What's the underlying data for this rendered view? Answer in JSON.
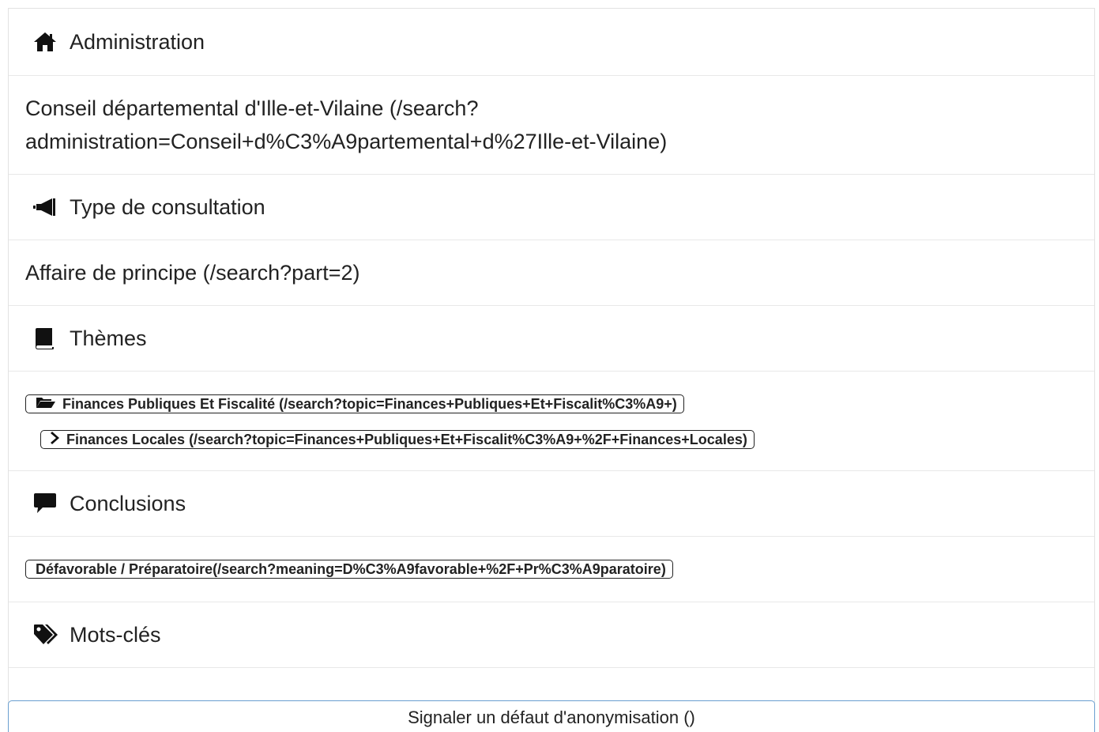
{
  "sections": {
    "administration": {
      "icon": "home-icon",
      "header": "Administration",
      "value_line1": "Conseil départemental d'Ille-et-Vilaine (/search?",
      "value_line2": "administration=Conseil+d%C3%A9partemental+d%27Ille-et-Vilaine)"
    },
    "consultation_type": {
      "icon": "megaphone-icon",
      "header": "Type de consultation",
      "value": "Affaire de principe (/search?part=2)"
    },
    "themes": {
      "icon": "book-icon",
      "header": "Thèmes",
      "topics": [
        {
          "icon": "folder-open-icon",
          "label": "Finances Publiques Et Fiscalité (/search?topic=Finances+Publiques+Et+Fiscalit%C3%A9+)"
        },
        {
          "icon": "chevron-right-icon",
          "label": "Finances Locales (/search?topic=Finances+Publiques+Et+Fiscalit%C3%A9+%2F+Finances+Locales)"
        }
      ]
    },
    "conclusions": {
      "icon": "comment-icon",
      "header": "Conclusions",
      "meaning": "Défavorable / Préparatoire(/search?meaning=D%C3%A9favorable+%2F+Pr%C3%A9paratoire)"
    },
    "keywords": {
      "icon": "tags-icon",
      "header": "Mots-clés"
    }
  },
  "report_button": {
    "label": "Signaler un défaut d'anonymisation ()"
  },
  "colors": {
    "text": "#222222",
    "divider": "#e8e8e8",
    "button_border": "#6a9fd0"
  }
}
